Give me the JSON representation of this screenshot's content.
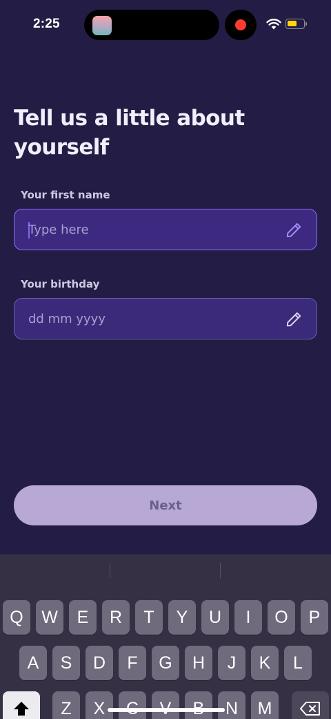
{
  "status": {
    "time": "2:25",
    "battery_color": "#ffd60a",
    "record_color": "#ff3b30"
  },
  "page": {
    "title": "Tell us a little about yourself"
  },
  "form": {
    "first_name": {
      "label": "Your first name",
      "placeholder": "Type here",
      "value": "",
      "icon": "pencil-icon"
    },
    "birthday": {
      "label": "Your birthday",
      "placeholder": "dd mm yyyy",
      "value": "",
      "icon": "pencil-icon"
    }
  },
  "actions": {
    "next_label": "Next"
  },
  "keyboard": {
    "row1": [
      "Q",
      "W",
      "E",
      "R",
      "T",
      "Y",
      "U",
      "I",
      "O",
      "P"
    ],
    "row2": [
      "A",
      "S",
      "D",
      "F",
      "G",
      "H",
      "J",
      "K",
      "L"
    ],
    "row3": [
      "Z",
      "X",
      "C",
      "V",
      "B",
      "N",
      "M"
    ],
    "shift_icon": "shift-icon",
    "delete_icon": "delete-icon"
  },
  "colors": {
    "background": "#231d45",
    "field": "#3b2a7a",
    "accent": "#8f6cf4",
    "button": "#b8a8d6"
  }
}
